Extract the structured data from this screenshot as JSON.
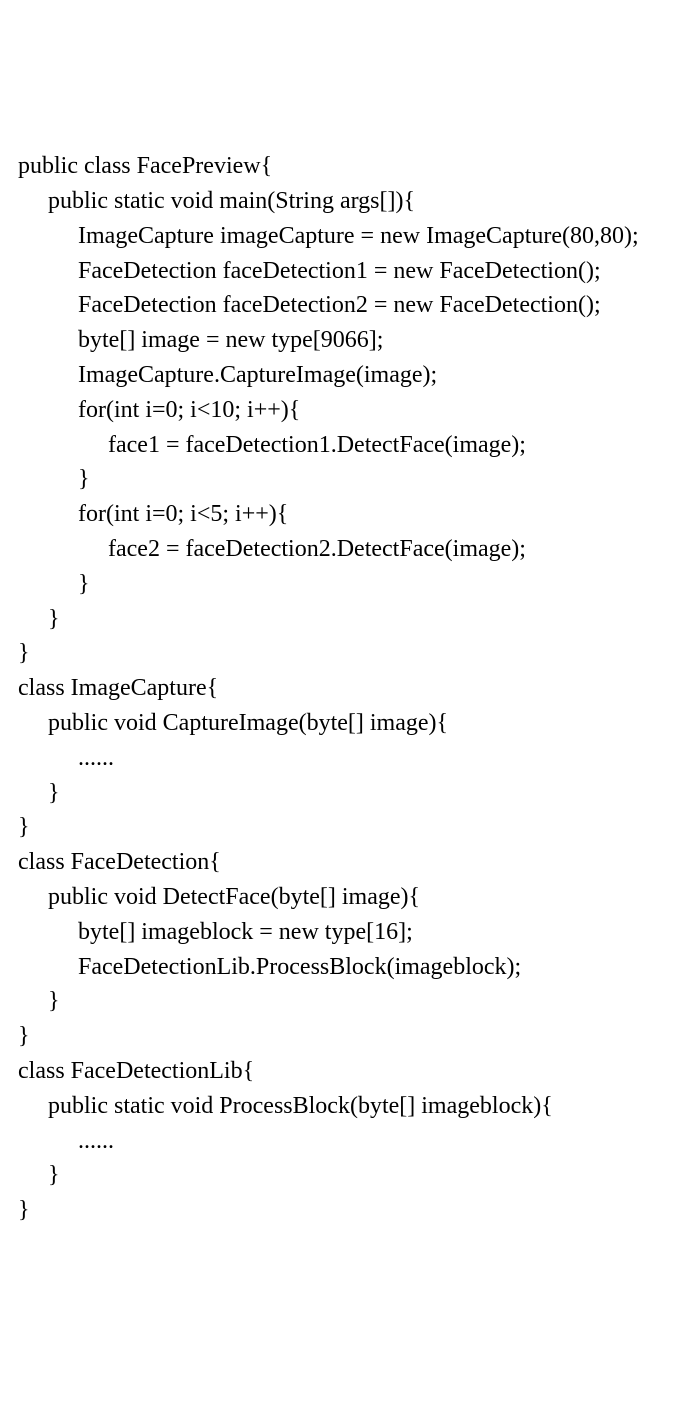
{
  "code": {
    "lines": [
      "public class FacePreview{",
      "     public static void main(String args[]){",
      "          ImageCapture imageCapture = new ImageCapture(80,80);",
      "          FaceDetection faceDetection1 = new FaceDetection();",
      "          FaceDetection faceDetection2 = new FaceDetection();",
      "          byte[] image = new type[9066];",
      "          ImageCapture.CaptureImage(image);",
      "          for(int i=0; i<10; i++){",
      "               face1 = faceDetection1.DetectFace(image);",
      "          }",
      "          for(int i=0; i<5; i++){",
      "               face2 = faceDetection2.DetectFace(image);",
      "          }",
      "     }",
      "}",
      "class ImageCapture{",
      "     public void CaptureImage(byte[] image){",
      "          ......",
      "     }",
      "}",
      "class FaceDetection{",
      "     public void DetectFace(byte[] image){",
      "          byte[] imageblock = new type[16];",
      "          FaceDetectionLib.ProcessBlock(imageblock);",
      "     }",
      "}",
      "class FaceDetectionLib{",
      "     public static void ProcessBlock(byte[] imageblock){",
      "          ......",
      "     }",
      "}"
    ]
  }
}
